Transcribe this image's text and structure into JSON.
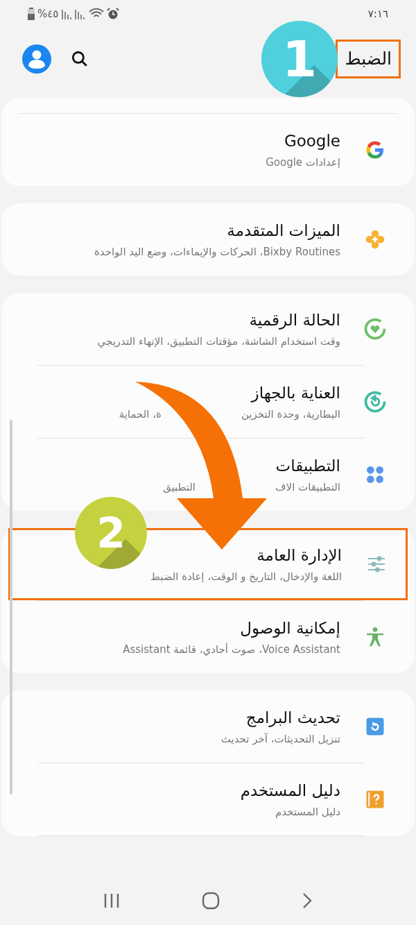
{
  "status_bar": {
    "time": "٧:١٦",
    "battery": "%٤٥"
  },
  "header": {
    "title": "الضبط",
    "highlighted": true
  },
  "groups": [
    {
      "top_strip": true,
      "items": [
        {
          "kind": "google",
          "title": "Google",
          "subtitle": "إعدادات Google",
          "highlighted": false
        }
      ]
    },
    {
      "items": [
        {
          "kind": "advanced",
          "title": "الميزات المتقدمة",
          "subtitle": "Bixby Routines، الحركات والإيماءات، وضع اليد الواحدة",
          "highlighted": false
        }
      ]
    },
    {
      "items": [
        {
          "kind": "wellbeing",
          "title": "الحالة الرقمية",
          "subtitle": "وقت استخدام الشاشة، مؤقتات التطبيق، الإنهاء التدريجي",
          "highlighted": false
        },
        {
          "kind": "care",
          "title": "العناية بالجهاز",
          "subtitle": [
            "البطارية، وحدة التخزين",
            "ة، الحماية"
          ],
          "highlighted": false
        },
        {
          "kind": "apps",
          "title": "التطبيقات",
          "subtitle": [
            "التطبيقات الاف",
            "التطبيق"
          ],
          "highlighted": false
        }
      ]
    },
    {
      "items": [
        {
          "kind": "general",
          "title": "الإدارة العامة",
          "subtitle": "اللغة والإدخال، التاريخ و الوقت، إعادة الضبط",
          "highlighted": true
        },
        {
          "kind": "accessibility",
          "title": "إمكانية الوصول",
          "subtitle": "Voice Assistant، صوت أحادي، قائمة Assistant",
          "highlighted": false
        }
      ]
    },
    {
      "items": [
        {
          "kind": "update",
          "title": "تحديث البرامج",
          "subtitle": "تنزيل التحديثات، آخر تحديث",
          "highlighted": false
        },
        {
          "kind": "manual",
          "title": "دليل المستخدم",
          "subtitle": "دليل المستخدم",
          "highlighted": false
        }
      ]
    }
  ],
  "annotations": [
    {
      "kind": "title",
      "label": "1",
      "color": "#4fd0dc"
    },
    {
      "kind": "row",
      "label": "2",
      "color": "#c5d13f"
    }
  ]
}
